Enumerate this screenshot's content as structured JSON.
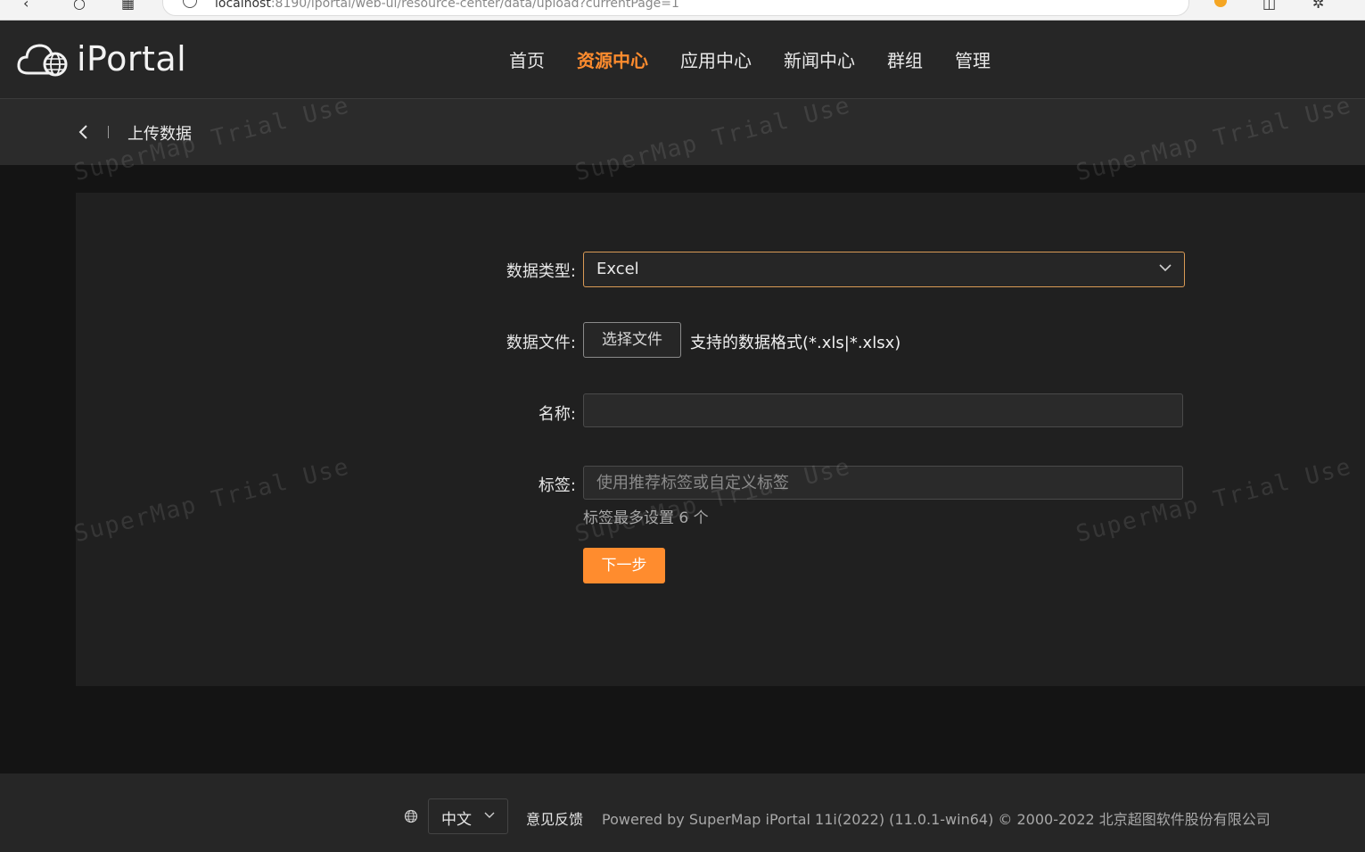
{
  "browser": {
    "url_host": "localhost",
    "url_rest": ":8190/iportal/web-ui/resource-center/data/upload?currentPage=1"
  },
  "header": {
    "logo_text": "iPortal",
    "nav": [
      {
        "label": "首页"
      },
      {
        "label": "资源中心",
        "active": true
      },
      {
        "label": "应用中心"
      },
      {
        "label": "新闻中心"
      },
      {
        "label": "群组"
      },
      {
        "label": "管理"
      }
    ]
  },
  "subheader": {
    "title": "上传数据"
  },
  "form": {
    "data_type_label": "数据类型:",
    "data_type_value": "Excel",
    "data_file_label": "数据文件:",
    "choose_file_button": "选择文件",
    "supported_formats": "支持的数据格式(*.xls|*.xlsx)",
    "name_label": "名称:",
    "name_value": "",
    "tags_label": "标签:",
    "tags_placeholder": "使用推荐标签或自定义标签",
    "tags_hint": "标签最多设置 6 个",
    "next_button": "下一步"
  },
  "footer": {
    "language": "中文",
    "feedback": "意见反馈",
    "powered_by": "Powered by SuperMap iPortal 11i(2022) (11.0.1-win64) © 2000-2022 北京超图软件股份有限公司"
  },
  "watermark": "SuperMap Trial Use",
  "colors": {
    "accent": "#ff8c2e",
    "header_bg": "#262626",
    "panel_bg": "#202020",
    "page_bg": "#141414"
  }
}
